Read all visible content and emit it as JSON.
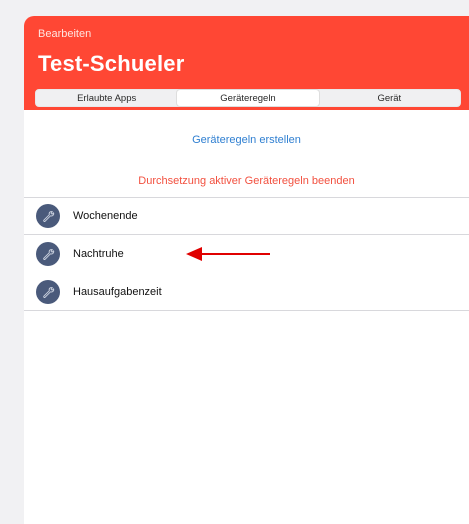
{
  "header": {
    "edit_label": "Bearbeiten",
    "title": "Test-Schueler",
    "tabs": [
      {
        "label": "Erlaubte Apps",
        "active": false
      },
      {
        "label": "Geräteregeln",
        "active": true
      },
      {
        "label": "Gerät",
        "active": false
      }
    ],
    "accent_color": "#ff4734"
  },
  "actions": {
    "create_label": "Geräteregeln erstellen",
    "stop_label": "Durchsetzung aktiver Geräteregeln beenden"
  },
  "rules": [
    {
      "label": "Wochenende",
      "icon": "wrench-icon"
    },
    {
      "label": "Nachtruhe",
      "icon": "wrench-icon"
    },
    {
      "label": "Hausaufgabenzeit",
      "icon": "wrench-icon"
    }
  ],
  "annotation": {
    "arrow_color": "#e00000",
    "points_to": "Nachtruhe"
  }
}
